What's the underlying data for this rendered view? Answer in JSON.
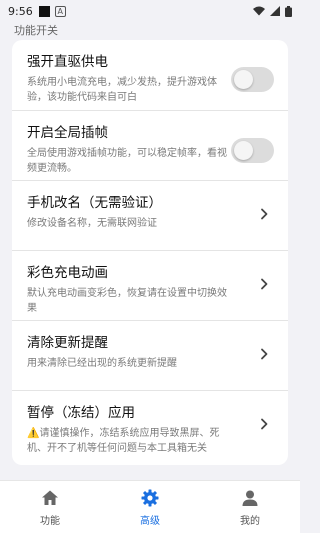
{
  "status_bar": {
    "time": "9:56",
    "app_icon_letter": "A"
  },
  "section_header": "功能开关",
  "settings": [
    {
      "title": "强开直驱供电",
      "desc": "系统用小电流充电，减少发热，提升游戏体验，该功能代码来自可白",
      "control": "toggle",
      "enabled": false
    },
    {
      "title": "开启全局插帧",
      "desc": "全局使用游戏插帧功能，可以稳定帧率，看视频更流畅。",
      "control": "toggle",
      "enabled": false
    },
    {
      "title": "手机改名（无需验证）",
      "desc": "修改设备名称，无需联网验证",
      "control": "chevron"
    },
    {
      "title": "彩色充电动画",
      "desc": "默认充电动画变彩色，恢复请在设置中切换效果",
      "control": "chevron"
    },
    {
      "title": "清除更新提醒",
      "desc": "用来清除已经出现的系统更新提醒",
      "control": "chevron"
    },
    {
      "title": "暂停（冻结）应用",
      "desc": "⚠️请谨慎操作，冻结系统应用导致黑屏、死机、开不了机等任何问题与本工具箱无关",
      "control": "chevron"
    }
  ],
  "bottom_nav": {
    "items": [
      {
        "label": "功能",
        "icon": "home-icon",
        "active": false
      },
      {
        "label": "高级",
        "icon": "gear-icon",
        "active": true
      },
      {
        "label": "我的",
        "icon": "person-icon",
        "active": false
      }
    ]
  },
  "colors": {
    "accent": "#1a6fe0",
    "background": "#f2f2f6",
    "card": "#ffffff",
    "toggle_off": "#dcdcdc"
  }
}
